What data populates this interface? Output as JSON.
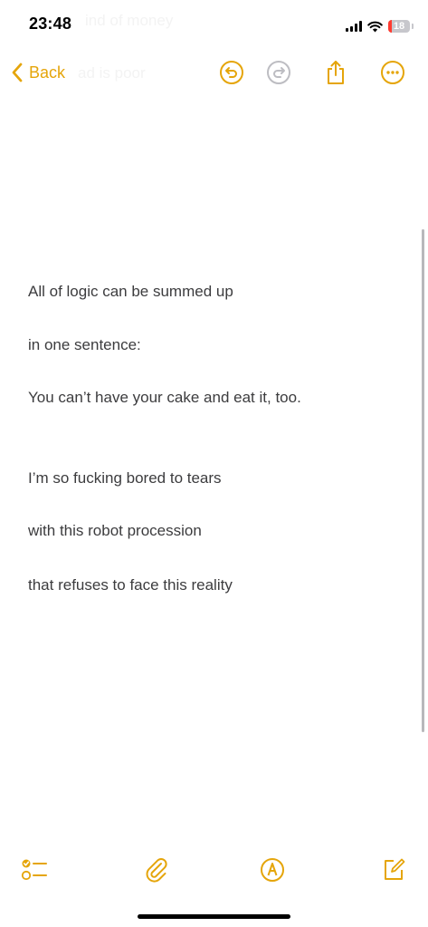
{
  "status_bar": {
    "time": "23:48",
    "battery_level": "18",
    "battery_fraction": 0.18,
    "signal_bars": 4
  },
  "background_text": {
    "line1": "ind of money",
    "line2": "ad is poor"
  },
  "nav": {
    "back_label": "Back",
    "accent_color": "#e5a50a",
    "icons": [
      "chevron-left-icon",
      "undo-icon",
      "redo-icon",
      "share-icon",
      "more-icon"
    ]
  },
  "note": {
    "lines": [
      "All of logic can be summed up",
      "in one sentence:",
      "You can’t have your cake and eat it, too.",
      "I’m so fucking bored to tears",
      "with this robot procession",
      "that refuses to face this reality"
    ]
  },
  "toolbar": {
    "icons": [
      "checklist-icon",
      "paperclip-icon",
      "markup-pen-icon",
      "compose-icon"
    ]
  }
}
